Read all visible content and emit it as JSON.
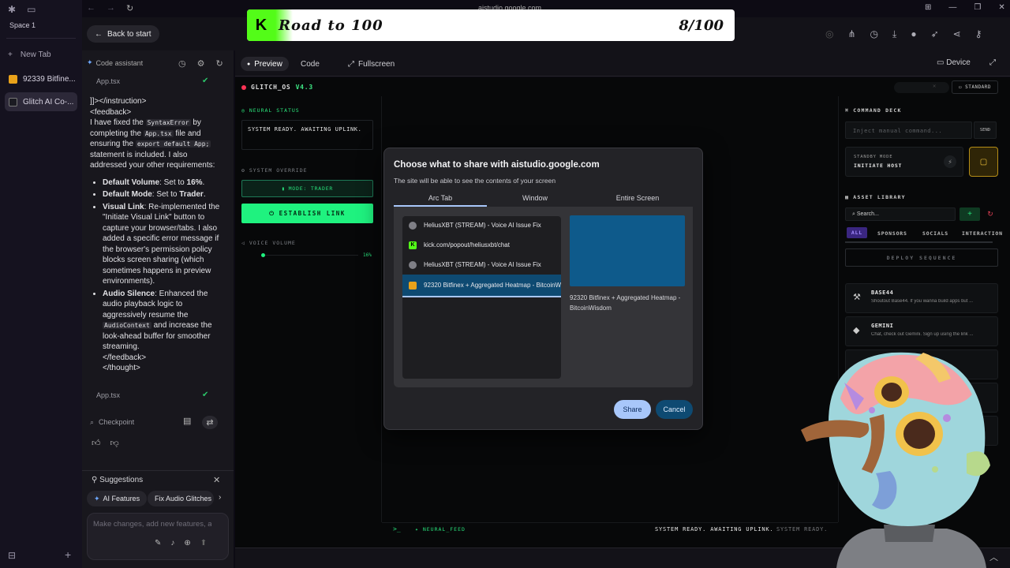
{
  "arc": {
    "space_label": "Space 1",
    "new_tab_label": "New Tab",
    "tabs": [
      {
        "label": "92339 Bitfine..."
      },
      {
        "label": "Glitch AI Co-..."
      }
    ],
    "url": "aistudio.google.com"
  },
  "banner": {
    "title": "Road to 100",
    "count": "8/100"
  },
  "header": {
    "back_label": "Back to start"
  },
  "assistant": {
    "title": "Code assistant",
    "file_top": "App.tsx",
    "file_bottom": "App.tsx",
    "intro_line1": "]]></instruction>",
    "intro_line2": "<feedback>",
    "intro_p1": "I have fixed the",
    "code_syntax": "SyntaxError",
    "intro_p2": "by completing the",
    "code_file": "App.tsx",
    "intro_p3": "file and ensuring the",
    "code_export": "export default App;",
    "intro_p4": "statement is included. I also addressed your other requirements:",
    "bullets": [
      {
        "bold": "Default Volume",
        "text": ": Set to ",
        "bold2": "16%",
        "tail": "."
      },
      {
        "bold": "Default Mode",
        "text": ": Set to ",
        "bold2": "Trader",
        "tail": "."
      },
      {
        "bold": "Visual Link",
        "text": ": Re-implemented the \"Initiate Visual Link\" button to capture your browser/tabs. I also added a specific error message if the browser's permission policy blocks screen sharing (which sometimes happens in preview environments).",
        "bold2": "",
        "tail": ""
      }
    ],
    "audio_bold": "Audio Silence",
    "audio_text1": ": Enhanced the audio playback logic to aggressively resume the",
    "audio_code": "AudioContext",
    "audio_text2": "and increase the look-ahead buffer for smoother streaming.",
    "close_feedback": "</feedback>",
    "close_thought": "</thought>",
    "checkpoint_label": "Checkpoint",
    "suggestions_label": "Suggestions",
    "chips": [
      "AI Features",
      "Fix Audio Glitches"
    ],
    "prompt_placeholder": "Make changes, add new features, ask for anything"
  },
  "preview_bar": {
    "tabs": [
      "Preview",
      "Code",
      "Fullscreen"
    ],
    "device_label": "Device"
  },
  "app": {
    "title": "GLITCH_OS",
    "version": "V4.3",
    "neural_status_label": "NEURAL STATUS",
    "status_text": "SYSTEM READY. AWAITING UPLINK.",
    "override_label": "SYSTEM OVERRIDE",
    "mode_label": "MODE: TRADER",
    "establish_label": "ESTABLISH LINK",
    "voice_label": "VOICE VOLUME",
    "volume_pct": "16%",
    "volume_level": 0.16,
    "feed_label": "NEURAL_FEED",
    "feed_text": "SYSTEM READY. AWAITING UPLINK.",
    "feed_text2": "SYSTEM READY. AWAITING UPLINK.",
    "standard_label": "STANDARD",
    "command_deck_label": "COMMAND DECK",
    "command_placeholder": "Inject manual command...",
    "send_label": "SEND",
    "standby_mode": "STANDBY MODE",
    "initiate_host": "INITIATE HOST",
    "asset_library_label": "ASSET LIBRARY",
    "search_placeholder": "Search...",
    "filters": [
      "ALL",
      "SPONSORS",
      "SOCIALS",
      "INTERACTION"
    ],
    "deploy_label": "DEPLOY SEQUENCE",
    "assets": [
      {
        "name": "BASE44",
        "desc": "Shoutout Base44. If you wanna build apps but ..."
      },
      {
        "name": "GEMINI",
        "desc": "Chat, check out Gemini. Sign up using the link ..."
      }
    ]
  },
  "share_dialog": {
    "title": "Choose what to share with aistudio.google.com",
    "subtitle": "The site will be able to see the contents of your screen",
    "tabs": [
      "Arc Tab",
      "Window",
      "Entire Screen"
    ],
    "items": [
      {
        "label": "HeliusXBT (STREAM) - Voice AI Issue Fix",
        "icon": "globe"
      },
      {
        "label": "kick.com/popout/heliusxbt/chat",
        "icon": "kick"
      },
      {
        "label": "HeliusXBT (STREAM) - Voice AI Issue Fix",
        "icon": "globe"
      },
      {
        "label": "92320 Bitfinex + Aggregated Heatmap - BitcoinWisdom",
        "icon": "btc"
      }
    ],
    "preview_caption": "92320 Bitfinex + Aggregated Heatmap - BitcoinWisdom",
    "share_label": "Share",
    "cancel_label": "Cancel"
  },
  "colors": {
    "accent_green": "#1ff27f",
    "kick_green": "#53fc18",
    "dialog_blue": "#a8c7fa"
  }
}
